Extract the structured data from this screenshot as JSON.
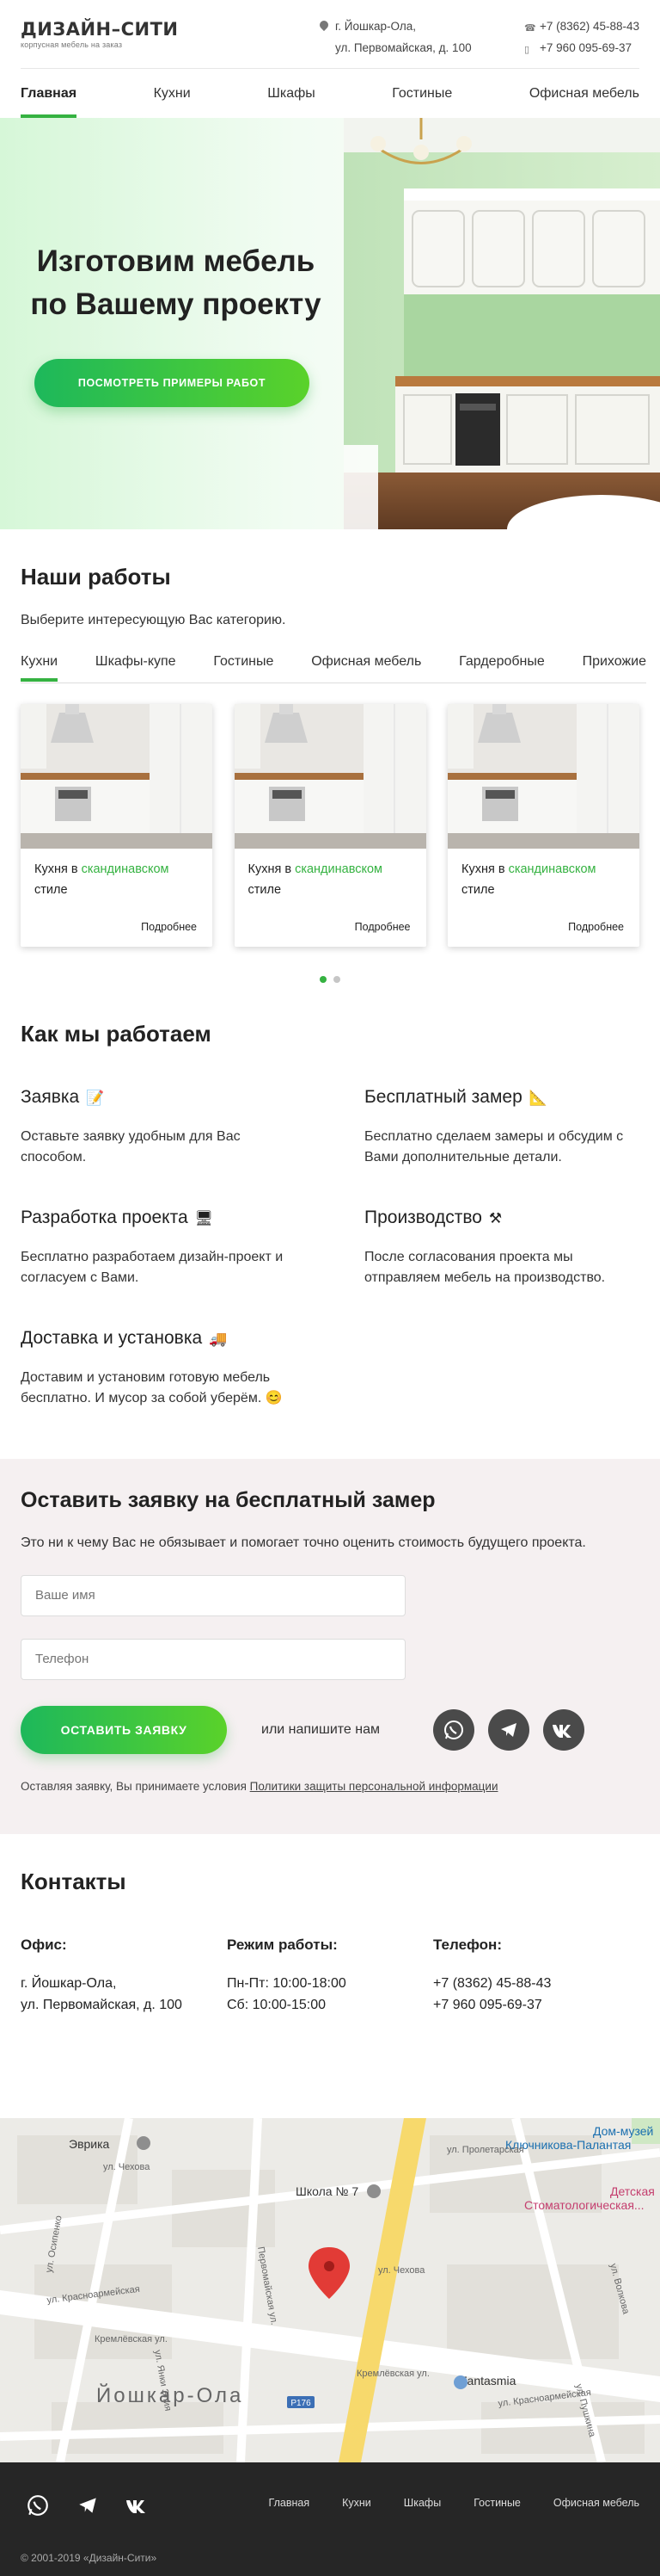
{
  "header": {
    "logo_title": "ДИЗАЙН–СИТИ",
    "logo_sub": "корпусная мебель на заказ",
    "address_line1": "г. Йошкар-Ола,",
    "address_line2": "ул. Первомайская, д. 100",
    "phone1": "+7 (8362) 45-88-43",
    "phone2": "+7 960 095-69-37"
  },
  "nav": [
    "Главная",
    "Кухни",
    "Шкафы",
    "Гостиные",
    "Офисная мебель"
  ],
  "hero": {
    "line1": "Изготовим мебель",
    "line2": "по Вашему проекту",
    "button": "ПОСМОТРЕТЬ ПРИМЕРЫ РАБОТ"
  },
  "works": {
    "title": "Наши работы",
    "lead": "Выберите интересующую Вас категорию.",
    "tabs": [
      "Кухни",
      "Шкафы-купе",
      "Гостиные",
      "Офисная мебель",
      "Гардеробные",
      "Прихожие"
    ],
    "card_prefix": "Кухня в ",
    "card_highlight": "скандинавском",
    "card_suffix": "стиле",
    "card_more": "Подробнее"
  },
  "how": {
    "title": "Как мы работаем",
    "steps": [
      {
        "title": "Заявка",
        "emoji": "📝",
        "text": "Оставьте заявку удобным для Вас способом."
      },
      {
        "title": "Бесплатный замер",
        "emoji": "📐",
        "text": "Бесплатно сделаем замеры и обсудим с Вами дополнительные детали."
      },
      {
        "title": "Разработка проекта",
        "emoji": "🖥",
        "text": "Бесплатно разработаем дизайн-проект и согласуем с Вами."
      },
      {
        "title": "Производство",
        "emoji": "⚒",
        "text": "После согласования проекта мы отправляем мебель на производство."
      },
      {
        "title": "Доставка и установка",
        "emoji": "🚚",
        "text": "Доставим и установим готовую мебель бесплатно. И мусор за собой уберём. 😊"
      }
    ]
  },
  "form": {
    "title": "Оставить заявку на бесплатный замер",
    "lead": "Это ни к чему Вас не обязывает и помогает точно оценить стоимость будущего проекта.",
    "name_placeholder": "Ваше имя",
    "phone_placeholder": "Телефон",
    "submit": "ОСТАВИТЬ ЗАЯВКУ",
    "or_text": "или напишите нам",
    "policy_text": "Оставляя заявку, Вы принимаете условия ",
    "policy_link": "Политики защиты персональной информации"
  },
  "contacts": {
    "title": "Контакты",
    "office_title": "Офис:",
    "office_line1": "г. Йошкар-Ола,",
    "office_line2": "ул. Первомайская, д. 100",
    "hours_title": "Режим работы:",
    "hours_line1": "Пн-Пт: 10:00-18:00",
    "hours_line2": "Сб: 10:00-15:00",
    "phone_title": "Телефон:",
    "phone_line1": "+7 (8362) 45-88-43",
    "phone_line2": "+7 960 095-69-37"
  },
  "map": {
    "labels": {
      "evrika": "Эврика",
      "museum": "Дом-музей",
      "museum2": "Ключникова-Палантая",
      "dental": "Детская",
      "dental2": "Стоматологическая...",
      "school": "Школа № 7",
      "city": "Йошкар-Ола",
      "fantasmia": "Fantasmia",
      "r176": "Р176",
      "st_chekhova": "ул. Чехова",
      "st_chekhova2": "ул. Чехова",
      "st_proletarskaya": "ул. Пролетарская",
      "st_krasnoarmeyskaya": "ул. Красноармейская",
      "st_krasnoarmeyskaya2": "ул. Красноармейская",
      "st_kremlevskaya": "Кремлёвская ул.",
      "st_kremlevskaya2": "Кремлёвская ул.",
      "st_pervomayskaya": "Первомайская ул.",
      "st_osipenko": "ул. Осипенко",
      "st_yanka": "ул. Янки Элия",
      "st_volkova": "ул. Волкова",
      "st_pushkina": "ул. Пушкина"
    }
  },
  "footer": {
    "nav": [
      "Главная",
      "Кухни",
      "Шкафы",
      "Гостиные",
      "Офисная мебель"
    ],
    "copyright": "© 2001-2019 «Дизайн-Сити»"
  },
  "colors": {
    "accent": "#35b241",
    "dark_footer": "#262626",
    "form_bg": "#f5f0f1"
  }
}
